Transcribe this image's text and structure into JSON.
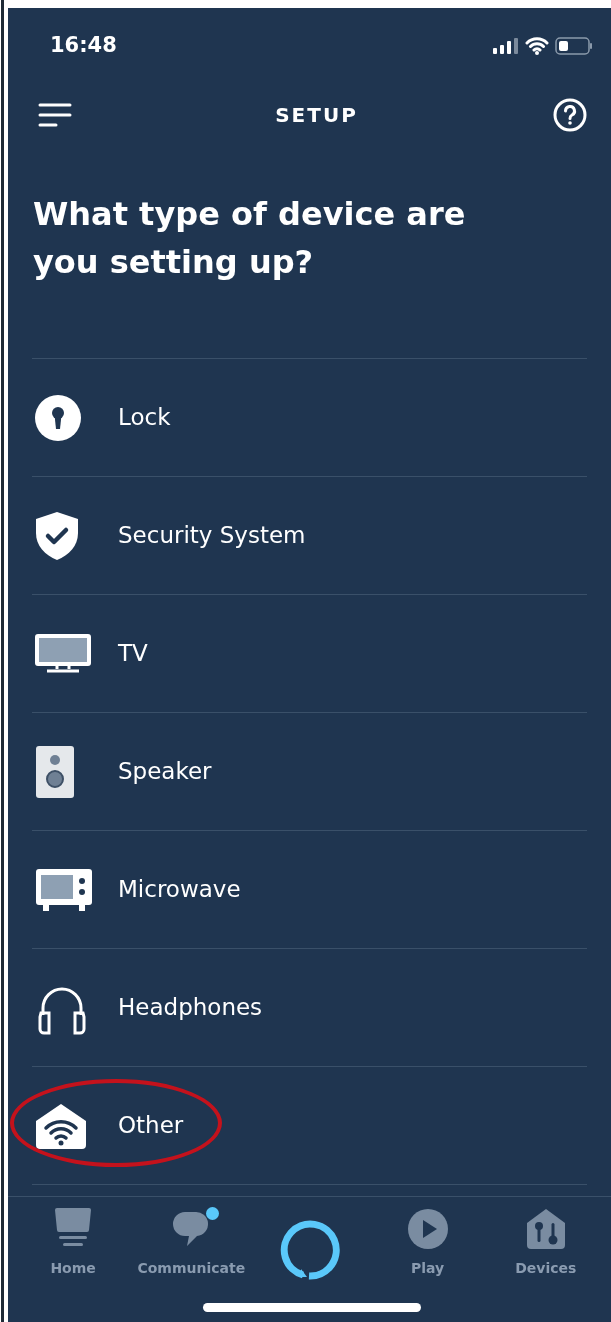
{
  "status_bar": {
    "time": "16:48"
  },
  "header": {
    "title": "SETUP"
  },
  "heading": "What type of device are you setting up?",
  "devices": [
    {
      "label": "Lock",
      "kind": "lock",
      "circled": false
    },
    {
      "label": "Security System",
      "kind": "shield",
      "circled": false
    },
    {
      "label": "TV",
      "kind": "tv",
      "circled": false
    },
    {
      "label": "Speaker",
      "kind": "speaker",
      "circled": false
    },
    {
      "label": "Microwave",
      "kind": "microwave",
      "circled": false
    },
    {
      "label": "Headphones",
      "kind": "headphones",
      "circled": false
    },
    {
      "label": "Other",
      "kind": "other",
      "circled": true
    }
  ],
  "tab_bar": [
    {
      "label": "Home",
      "kind": "home",
      "badge": false
    },
    {
      "label": "Communicate",
      "kind": "communicate",
      "badge": true
    },
    {
      "kind": "alexa",
      "badge": false
    },
    {
      "label": "Play",
      "kind": "play",
      "badge": false
    },
    {
      "label": "Devices",
      "kind": "devices",
      "badge": false
    }
  ]
}
